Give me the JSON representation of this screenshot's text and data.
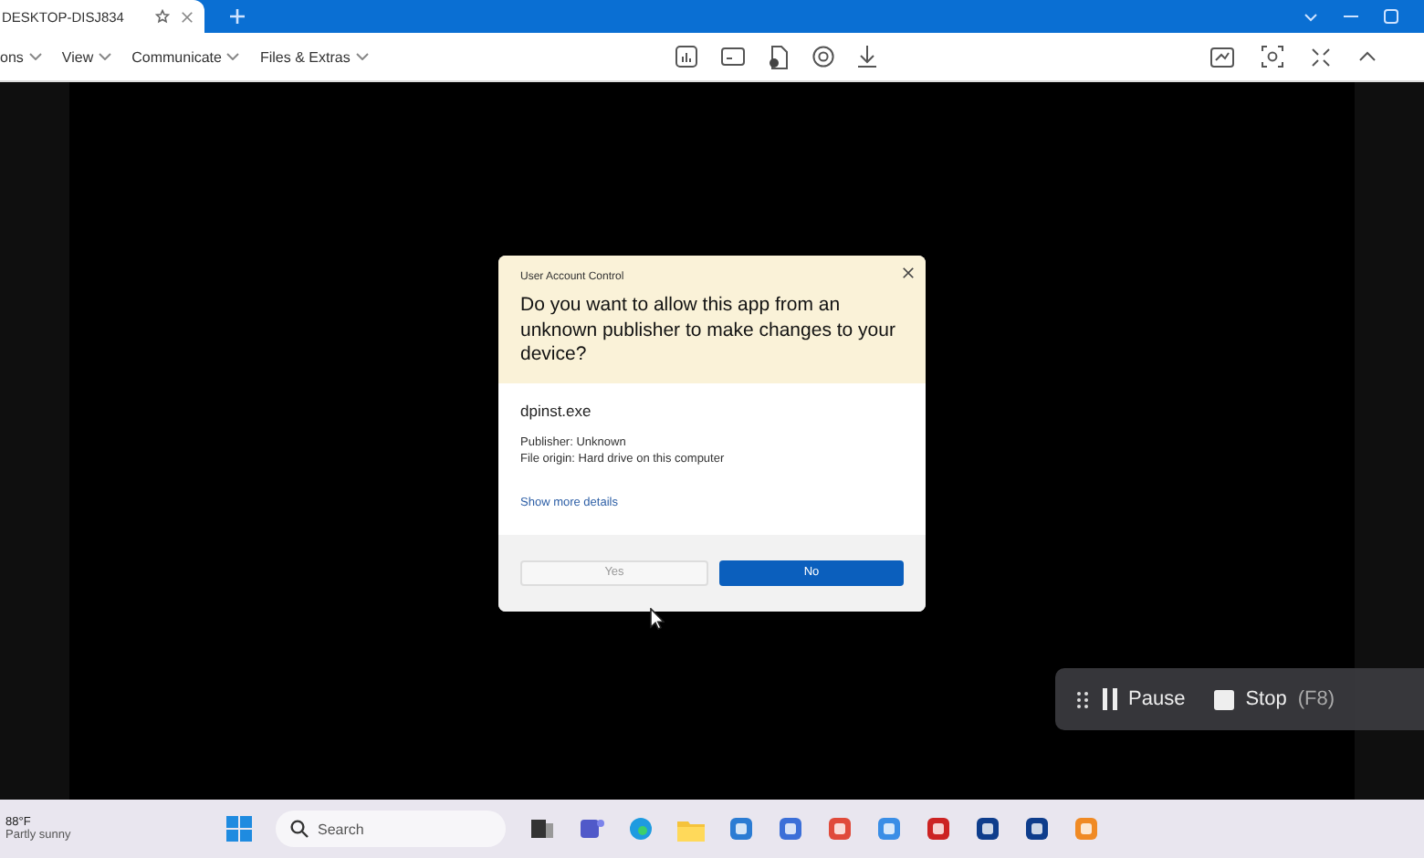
{
  "remote_window": {
    "tab": {
      "title": "DESKTOP-DISJ834"
    },
    "menu": [
      {
        "label": "ons"
      },
      {
        "label": "View"
      },
      {
        "label": "Communicate"
      },
      {
        "label": "Files & Extras"
      }
    ]
  },
  "dialog": {
    "header": "User Account Control",
    "question": "Do you want to allow this app from an unknown publisher to make changes to your device?",
    "program": "dpinst.exe",
    "publisher": "Publisher: Unknown",
    "origin": "File origin: Hard drive on this computer",
    "details_link": "Show more details",
    "buttons": [
      {
        "label": "Yes",
        "kind": "secondary"
      },
      {
        "label": "No",
        "kind": "primary"
      }
    ]
  },
  "taskbar": {
    "weather": {
      "temp": "88°F",
      "condition": "Partly sunny"
    },
    "search": {
      "placeholder": "Search"
    }
  },
  "recorder": {
    "pause": "Pause",
    "stop": "Stop",
    "shortcut": "(F8)"
  }
}
